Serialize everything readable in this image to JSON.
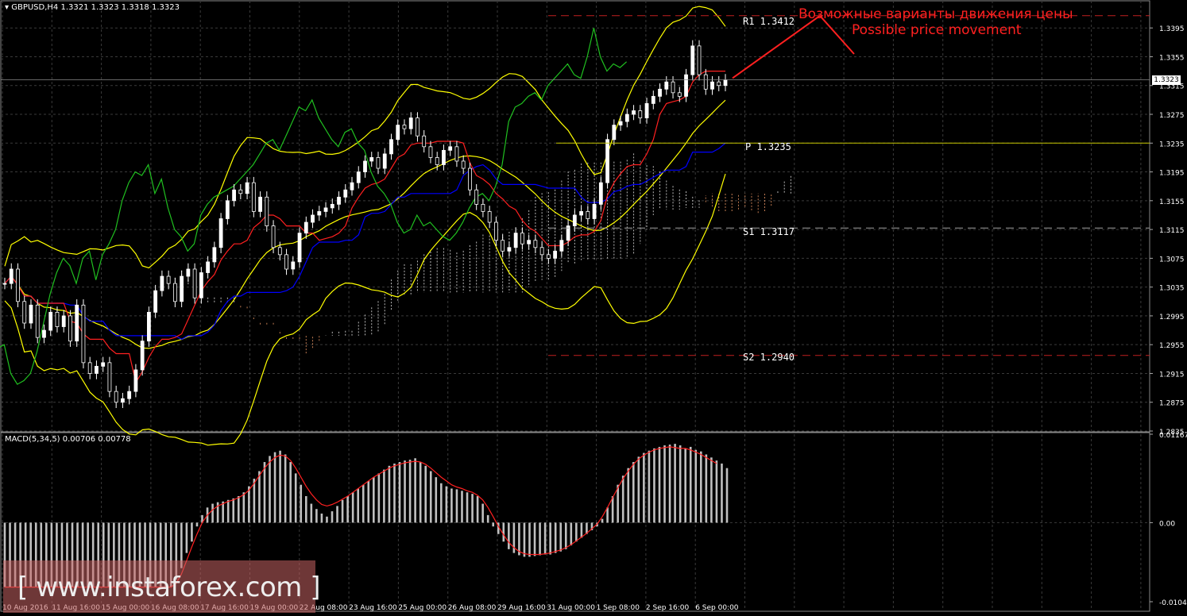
{
  "window": {
    "symbol_header": "GBPUSD,H4  1.3321 1.3323 1.3318 1.3323",
    "macd_header": "MACD(5,34,5) 0.00706 0.00778",
    "current_price": "1.3323"
  },
  "annotation": {
    "ru": "Возможные варианты движения цены",
    "en": "Possible price movement"
  },
  "levels": [
    {
      "name": "R1",
      "label": "R1 1.3412",
      "value": 1.3412,
      "style": "dashed",
      "color": "#c02020"
    },
    {
      "name": "P",
      "label": "P 1.3235",
      "value": 1.3235,
      "style": "solid",
      "color": "#c8c800"
    },
    {
      "name": "S1",
      "label": "S1 1.3117",
      "value": 1.3117,
      "style": "dashed",
      "color": "#a0a0a0"
    },
    {
      "name": "S2",
      "label": "S2 1.2940",
      "value": 1.294,
      "style": "dashed",
      "color": "#c02020"
    }
  ],
  "watermark": "[ www.instaforex.com ]",
  "colors": {
    "background": "#000000",
    "grid": "#3a3a3a",
    "candle": "#ffffff",
    "bollinger": "#ffff00",
    "tenkan": "#ff2020",
    "kijun": "#0000ff",
    "chikou": "#20c020",
    "cloud_bull": "#d8d8d8",
    "cloud_bear": "#e09060",
    "macd_hist": "#c0c0c0",
    "macd_signal": "#ff2020",
    "arrow": "#ff2020",
    "annotation_text": "#ff2020"
  },
  "chart_data": [
    {
      "type": "candlestick",
      "title": "GBPUSD,H4",
      "y_ticks": [
        "1.3395",
        "1.3355",
        "1.3315",
        "1.3275",
        "1.3235",
        "1.3195",
        "1.3155",
        "1.3115",
        "1.3075",
        "1.3035",
        "1.2995",
        "1.2955",
        "1.2915",
        "1.2875",
        "1.2835"
      ],
      "ylim": [
        1.2835,
        1.3425
      ],
      "x_labels": [
        "10 Aug 2016",
        "11 Aug 16:00",
        "15 Aug 00:00",
        "16 Aug 08:00",
        "17 Aug 16:00",
        "19 Aug 00:00",
        "22 Aug 08:00",
        "23 Aug 16:00",
        "25 Aug 00:00",
        "26 Aug 08:00",
        "29 Aug 16:00",
        "31 Aug 00:00",
        "1 Sep 08:00",
        "2 Sep 16:00",
        "6 Sep 00:00"
      ],
      "close_series": [
        1.304,
        1.306,
        1.3015,
        1.2985,
        1.301,
        1.2965,
        1.2975,
        1.3,
        1.298,
        1.2995,
        1.296,
        1.301,
        1.293,
        1.2915,
        1.2925,
        1.293,
        1.289,
        1.2875,
        1.288,
        1.289,
        1.292,
        1.296,
        1.3,
        1.303,
        1.305,
        1.304,
        1.3015,
        1.305,
        1.306,
        1.302,
        1.3055,
        1.307,
        1.309,
        1.313,
        1.3155,
        1.317,
        1.3165,
        1.318,
        1.314,
        1.316,
        1.312,
        1.309,
        1.308,
        1.306,
        1.307,
        1.311,
        1.3125,
        1.3135,
        1.314,
        1.3145,
        1.315,
        1.316,
        1.317,
        1.318,
        1.3195,
        1.321,
        1.3215,
        1.32,
        1.322,
        1.324,
        1.326,
        1.3255,
        1.327,
        1.3245,
        1.323,
        1.3215,
        1.3205,
        1.3225,
        1.323,
        1.321,
        1.32,
        1.317,
        1.315,
        1.314,
        1.3125,
        1.31,
        1.3085,
        1.309,
        1.311,
        1.3095,
        1.31,
        1.309,
        1.308,
        1.3075,
        1.3085,
        1.31,
        1.312,
        1.3135,
        1.314,
        1.313,
        1.315,
        1.318,
        1.324,
        1.326,
        1.3265,
        1.3275,
        1.328,
        1.327,
        1.329,
        1.33,
        1.331,
        1.332,
        1.3305,
        1.33,
        1.333,
        1.337,
        1.333,
        1.331,
        1.332,
        1.3315,
        1.3323
      ],
      "pivot_levels": {
        "R1": 1.3412,
        "P": 1.3235,
        "S1": 1.3117,
        "S2": 1.294
      },
      "legend": "none",
      "grid": true
    },
    {
      "type": "bar",
      "title": "MACD(5,34,5)",
      "y_ticks": [
        "0.01167",
        "0.00",
        "-0.01043"
      ],
      "ylim": [
        -0.01043,
        0.01167
      ],
      "histogram": [
        -0.0085,
        -0.0085,
        -0.0085,
        -0.0085,
        -0.0085,
        -0.0085,
        -0.0085,
        -0.0085,
        -0.0085,
        -0.0085,
        -0.0085,
        -0.0085,
        -0.0085,
        -0.0085,
        -0.0085,
        -0.0085,
        -0.0085,
        -0.0085,
        -0.0085,
        -0.0085,
        -0.0085,
        -0.0085,
        -0.0085,
        -0.0085,
        -0.0085,
        -0.0085,
        -0.0085,
        -0.0085,
        -0.0085,
        -0.0085,
        -0.0085,
        -0.0085,
        -0.0085,
        -0.0075,
        -0.006,
        -0.004,
        -0.0025,
        -0.0005,
        0.001,
        0.002,
        0.0025,
        0.0027,
        0.0028,
        0.003,
        0.0032,
        0.0035,
        0.004,
        0.0048,
        0.0058,
        0.0068,
        0.008,
        0.0088,
        0.0093,
        0.0095,
        0.009,
        0.008,
        0.0065,
        0.005,
        0.0035,
        0.0025,
        0.0018,
        0.0012,
        0.0008,
        0.0015,
        0.0022,
        0.003,
        0.0035,
        0.004,
        0.0045,
        0.005,
        0.0055,
        0.006,
        0.0065,
        0.007,
        0.0075,
        0.0078,
        0.008,
        0.0082,
        0.0083,
        0.0085,
        0.008,
        0.0075,
        0.0068,
        0.006,
        0.0052,
        0.0048,
        0.0045,
        0.0044,
        0.0042,
        0.004,
        0.0038,
        0.0035,
        0.0025,
        0.001,
        -0.0005,
        -0.0015,
        -0.0025,
        -0.0035,
        -0.004,
        -0.0043,
        -0.0045,
        -0.0045,
        -0.0044,
        -0.0043,
        -0.0042,
        -0.0042,
        -0.004,
        -0.0038,
        -0.0035,
        -0.003,
        -0.0025,
        -0.002,
        -0.0015,
        -0.001,
        -0.0005,
        0.0005,
        0.002,
        0.0035,
        0.005,
        0.0062,
        0.0072,
        0.008,
        0.0087,
        0.0092,
        0.0095,
        0.0098,
        0.01,
        0.0102,
        0.0103,
        0.0104,
        0.0102,
        0.0098,
        0.01,
        0.0096,
        0.0094,
        0.009,
        0.0086,
        0.0082,
        0.0078,
        0.0072
      ],
      "signal": [
        -0.0085,
        -0.0085,
        -0.0085,
        -0.0085,
        -0.0085,
        -0.0085,
        -0.0085,
        -0.0085,
        -0.0085,
        -0.0085,
        -0.0085,
        -0.0085,
        -0.0085,
        -0.0085,
        -0.0085,
        -0.0085,
        -0.0085,
        -0.0085,
        -0.0085,
        -0.0085,
        -0.0085,
        -0.0085,
        -0.0085,
        -0.0085,
        -0.0085,
        -0.0085,
        -0.0085,
        -0.0085,
        -0.0085,
        -0.0085,
        -0.0085,
        -0.0085,
        -0.0085,
        -0.008,
        -0.0068,
        -0.005,
        -0.0032,
        -0.0015,
        0.0,
        0.001,
        0.0017,
        0.0022,
        0.0025,
        0.0028,
        0.003,
        0.0033,
        0.0037,
        0.0043,
        0.0052,
        0.0062,
        0.0072,
        0.008,
        0.0086,
        0.0089,
        0.0088,
        0.0082,
        0.0072,
        0.006,
        0.0048,
        0.0038,
        0.003,
        0.0024,
        0.0022,
        0.0024,
        0.0027,
        0.0031,
        0.0035,
        0.004,
        0.0045,
        0.005,
        0.0055,
        0.006,
        0.0064,
        0.0068,
        0.0072,
        0.0075,
        0.0077,
        0.0079,
        0.008,
        0.0081,
        0.008,
        0.0077,
        0.0072,
        0.0066,
        0.006,
        0.0055,
        0.005,
        0.0047,
        0.0045,
        0.0042,
        0.004,
        0.0036,
        0.003,
        0.002,
        0.0008,
        -0.0005,
        -0.0016,
        -0.0026,
        -0.0033,
        -0.0038,
        -0.0041,
        -0.0042,
        -0.0042,
        -0.0042,
        -0.0041,
        -0.004,
        -0.0038,
        -0.0036,
        -0.0033,
        -0.0029,
        -0.0024,
        -0.0019,
        -0.0014,
        -0.0008,
        -0.0002,
        0.0008,
        0.002,
        0.0033,
        0.0046,
        0.0058,
        0.0068,
        0.0077,
        0.0084,
        0.0089,
        0.0093,
        0.0096,
        0.0098,
        0.0099,
        0.01,
        0.0099,
        0.0098,
        0.0098,
        0.0096,
        0.0093,
        0.009,
        0.0086,
        0.0082,
        0.0078
      ],
      "values_shown": {
        "macd": 0.00706,
        "signal": 0.00778
      },
      "legend": "none",
      "grid": true
    }
  ]
}
